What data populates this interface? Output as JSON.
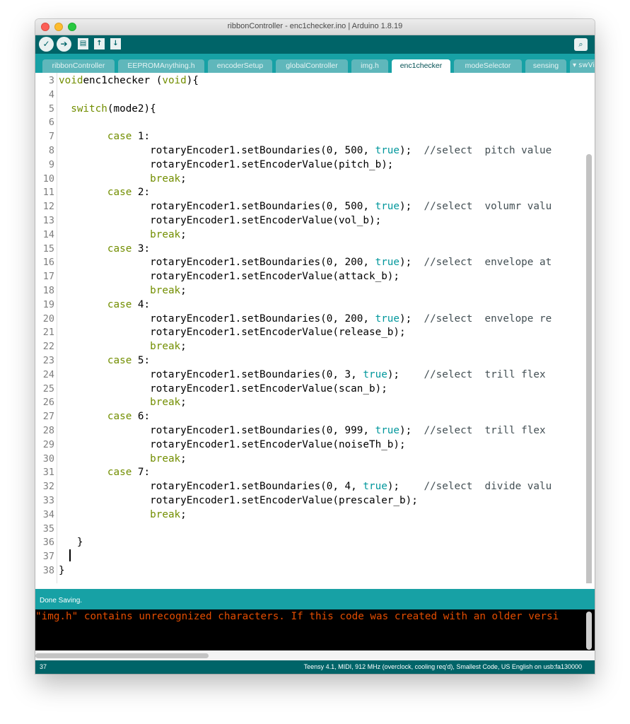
{
  "window": {
    "title": "ribbonController - enc1checker.ino | Arduino 1.8.19"
  },
  "toolbar": {
    "verify_icon": "✓",
    "upload_icon": "➔",
    "new_icon": "▤",
    "open_icon": "↑",
    "save_icon": "↓",
    "serial_icon": "⌕"
  },
  "tabs": [
    {
      "label": "ribbonController"
    },
    {
      "label": "EEPROMAnything.h"
    },
    {
      "label": "encoderSetup"
    },
    {
      "label": "globalController"
    },
    {
      "label": "img.h"
    },
    {
      "label": "enc1checker"
    },
    {
      "label": "modeSelector"
    },
    {
      "label": "sensing"
    }
  ],
  "tab_overflow": "▾ swVi",
  "code": {
    "lines": [
      {
        "n": "3",
        "parts": [
          [
            "kw2",
            "void"
          ],
          [
            "",
            "enc1checker "
          ],
          [
            "",
            "("
          ],
          [
            "kw2",
            "void"
          ],
          [
            "",
            "){"
          ]
        ]
      },
      {
        "n": "4",
        "parts": []
      },
      {
        "n": "5",
        "parts": [
          [
            "",
            "  "
          ],
          [
            "kw2",
            "switch"
          ],
          [
            "",
            "(mode2){"
          ]
        ]
      },
      {
        "n": "6",
        "parts": []
      },
      {
        "n": "7",
        "parts": [
          [
            "",
            "        "
          ],
          [
            "kw2",
            "case"
          ],
          [
            "",
            " 1:"
          ]
        ]
      },
      {
        "n": "8",
        "parts": [
          [
            "",
            "               rotaryEncoder1.setBoundaries(0, 500, "
          ],
          [
            "kw",
            "true"
          ],
          [
            "",
            "); "
          ],
          [
            "cm",
            " //select  pitch value"
          ]
        ]
      },
      {
        "n": "9",
        "parts": [
          [
            "",
            "               rotaryEncoder1.setEncoderValue(pitch_b);"
          ]
        ]
      },
      {
        "n": "10",
        "parts": [
          [
            "",
            "               "
          ],
          [
            "kw2",
            "break"
          ],
          [
            "",
            ";"
          ]
        ]
      },
      {
        "n": "11",
        "parts": [
          [
            "",
            "        "
          ],
          [
            "kw2",
            "case"
          ],
          [
            "",
            " 2:"
          ]
        ]
      },
      {
        "n": "12",
        "parts": [
          [
            "",
            "               rotaryEncoder1.setBoundaries(0, 500, "
          ],
          [
            "kw",
            "true"
          ],
          [
            "",
            "); "
          ],
          [
            "cm",
            " //select  volumr valu"
          ]
        ]
      },
      {
        "n": "13",
        "parts": [
          [
            "",
            "               rotaryEncoder1.setEncoderValue(vol_b);"
          ]
        ]
      },
      {
        "n": "14",
        "parts": [
          [
            "",
            "               "
          ],
          [
            "kw2",
            "break"
          ],
          [
            "",
            ";"
          ]
        ]
      },
      {
        "n": "15",
        "parts": [
          [
            "",
            "        "
          ],
          [
            "kw2",
            "case"
          ],
          [
            "",
            " 3:"
          ]
        ]
      },
      {
        "n": "16",
        "parts": [
          [
            "",
            "               rotaryEncoder1.setBoundaries(0, 200, "
          ],
          [
            "kw",
            "true"
          ],
          [
            "",
            "); "
          ],
          [
            "cm",
            " //select  envelope at"
          ]
        ]
      },
      {
        "n": "17",
        "parts": [
          [
            "",
            "               rotaryEncoder1.setEncoderValue(attack_b);"
          ]
        ]
      },
      {
        "n": "18",
        "parts": [
          [
            "",
            "               "
          ],
          [
            "kw2",
            "break"
          ],
          [
            "",
            ";"
          ]
        ]
      },
      {
        "n": "19",
        "parts": [
          [
            "",
            "        "
          ],
          [
            "kw2",
            "case"
          ],
          [
            "",
            " 4:"
          ]
        ]
      },
      {
        "n": "20",
        "parts": [
          [
            "",
            "               rotaryEncoder1.setBoundaries(0, 200, "
          ],
          [
            "kw",
            "true"
          ],
          [
            "",
            "); "
          ],
          [
            "cm",
            " //select  envelope re"
          ]
        ]
      },
      {
        "n": "21",
        "parts": [
          [
            "",
            "               rotaryEncoder1.setEncoderValue(release_b);"
          ]
        ]
      },
      {
        "n": "22",
        "parts": [
          [
            "",
            "               "
          ],
          [
            "kw2",
            "break"
          ],
          [
            "",
            ";"
          ]
        ]
      },
      {
        "n": "23",
        "parts": [
          [
            "",
            "        "
          ],
          [
            "kw2",
            "case"
          ],
          [
            "",
            " 5:"
          ]
        ]
      },
      {
        "n": "24",
        "parts": [
          [
            "",
            "               rotaryEncoder1.setBoundaries(0, 3, "
          ],
          [
            "kw",
            "true"
          ],
          [
            "",
            ");   "
          ],
          [
            "cm",
            " //select  trill flex"
          ]
        ]
      },
      {
        "n": "25",
        "parts": [
          [
            "",
            "               rotaryEncoder1.setEncoderValue(scan_b);"
          ]
        ]
      },
      {
        "n": "26",
        "parts": [
          [
            "",
            "               "
          ],
          [
            "kw2",
            "break"
          ],
          [
            "",
            ";"
          ]
        ]
      },
      {
        "n": "27",
        "parts": [
          [
            "",
            "        "
          ],
          [
            "kw2",
            "case"
          ],
          [
            "",
            " 6:"
          ]
        ]
      },
      {
        "n": "28",
        "parts": [
          [
            "",
            "               rotaryEncoder1.setBoundaries(0, 999, "
          ],
          [
            "kw",
            "true"
          ],
          [
            "",
            "); "
          ],
          [
            "cm",
            " //select  trill flex"
          ]
        ]
      },
      {
        "n": "29",
        "parts": [
          [
            "",
            "               rotaryEncoder1.setEncoderValue(noiseTh_b);"
          ]
        ]
      },
      {
        "n": "30",
        "parts": [
          [
            "",
            "               "
          ],
          [
            "kw2",
            "break"
          ],
          [
            "",
            ";"
          ]
        ]
      },
      {
        "n": "31",
        "parts": [
          [
            "",
            "        "
          ],
          [
            "kw2",
            "case"
          ],
          [
            "",
            " 7:"
          ]
        ]
      },
      {
        "n": "32",
        "parts": [
          [
            "",
            "               rotaryEncoder1.setBoundaries(0, 4, "
          ],
          [
            "kw",
            "true"
          ],
          [
            "",
            ");   "
          ],
          [
            "cm",
            " //select  divide valu"
          ]
        ]
      },
      {
        "n": "33",
        "parts": [
          [
            "",
            "               rotaryEncoder1.setEncoderValue(prescaler_b);"
          ]
        ]
      },
      {
        "n": "34",
        "parts": [
          [
            "",
            "               "
          ],
          [
            "kw2",
            "break"
          ],
          [
            "",
            ";"
          ]
        ]
      },
      {
        "n": "35",
        "parts": []
      },
      {
        "n": "36",
        "parts": [
          [
            "",
            "   }"
          ]
        ]
      },
      {
        "n": "37",
        "parts": []
      },
      {
        "n": "38",
        "parts": [
          [
            "",
            "}"
          ]
        ]
      }
    ]
  },
  "status": {
    "message": "Done Saving."
  },
  "console": {
    "text": "\"img.h\" contains unrecognized characters. If this code was created with an older versi"
  },
  "footer": {
    "line_number": "37",
    "board": "Teensy 4.1, MIDI, 912 MHz (overclock, cooling req'd), Smallest Code, US English on usb:fa130000"
  }
}
